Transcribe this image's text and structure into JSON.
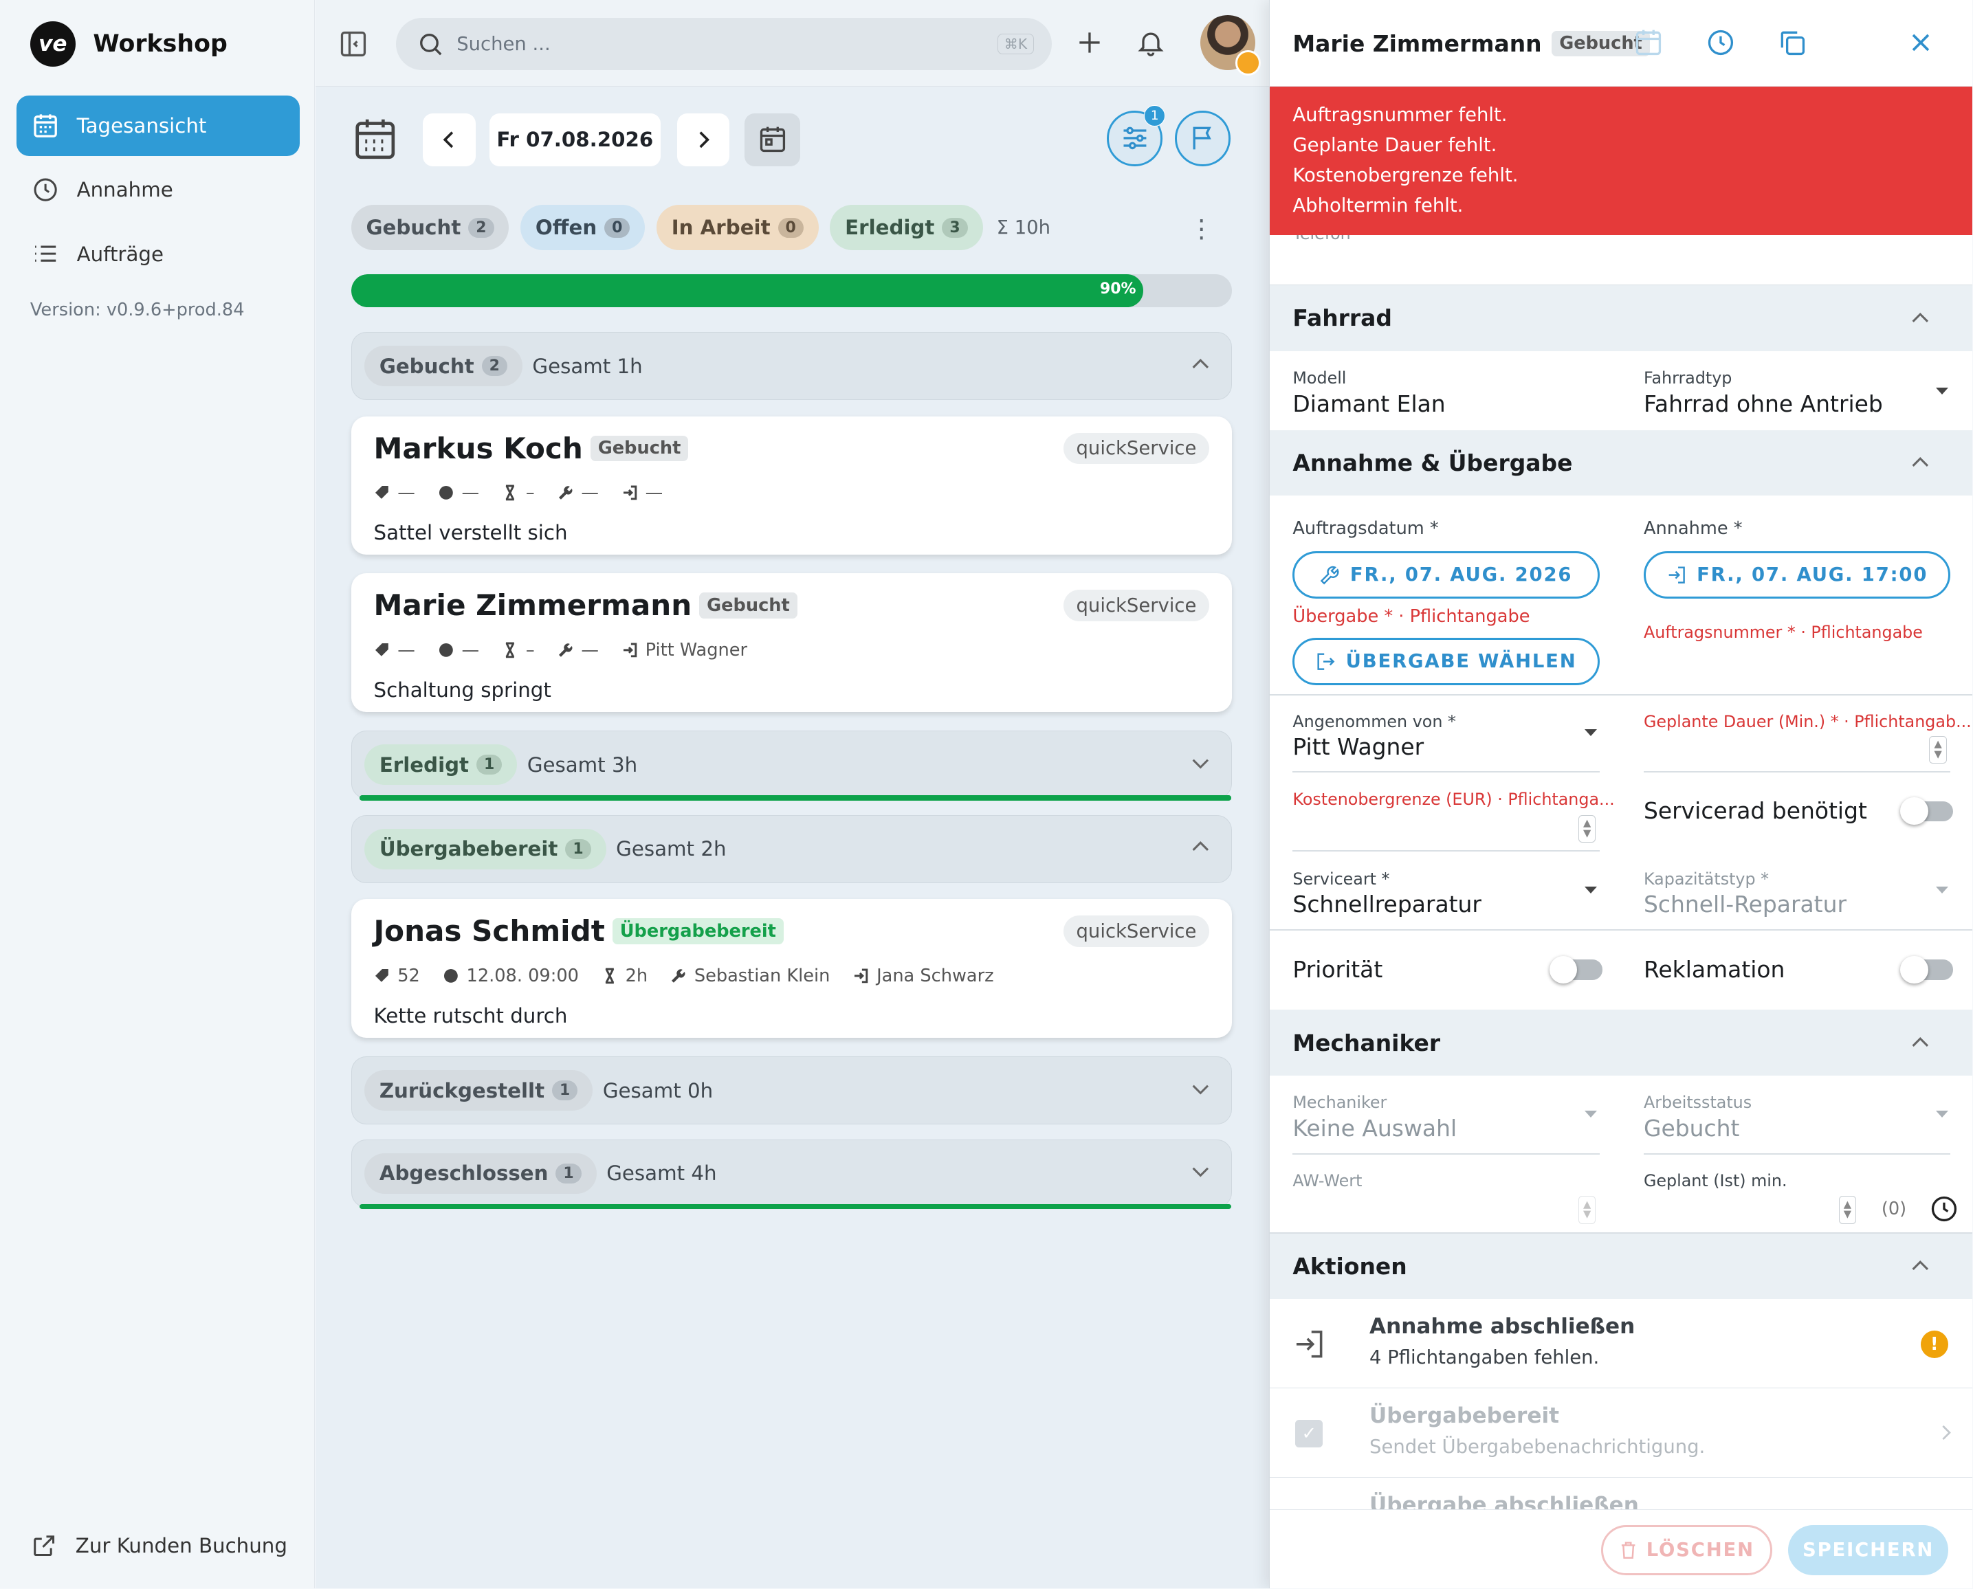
{
  "app": {
    "name": "Workshop",
    "version": "Version: v0.9.6+prod.84"
  },
  "sidebar": {
    "items": [
      {
        "label": "Tagesansicht",
        "icon": "calendar-icon",
        "active": true
      },
      {
        "label": "Annahme",
        "icon": "clock-icon"
      },
      {
        "label": "Aufträge",
        "icon": "list-icon"
      }
    ],
    "customer_link": "Zur Kunden Buchung"
  },
  "topbar": {
    "search_placeholder": "Suchen ...",
    "shortcut": "⌘K"
  },
  "datebar": {
    "date": "Fr 07.08.2026",
    "filter_badge": "1"
  },
  "status_chips": [
    {
      "label": "Gebucht",
      "count": "2"
    },
    {
      "label": "Offen",
      "count": "0"
    },
    {
      "label": "In Arbeit",
      "count": "0"
    },
    {
      "label": "Erledigt",
      "count": "3"
    }
  ],
  "sum_hours": "Σ 10h",
  "progress": {
    "value": 0.9,
    "label": "90%"
  },
  "groups": {
    "gebucht": {
      "label": "Gebucht",
      "count": "2",
      "total": "Gesamt 1h"
    },
    "erledigt": {
      "label": "Erledigt",
      "count": "1",
      "total": "Gesamt 3h"
    },
    "uebergabebereit": {
      "label": "Übergabebereit",
      "count": "1",
      "total": "Gesamt 2h"
    },
    "zurueckgestellt": {
      "label": "Zurückgestellt",
      "count": "1",
      "total": "Gesamt 0h"
    },
    "abgeschlossen": {
      "label": "Abgeschlossen",
      "count": "1",
      "total": "Gesamt 4h"
    }
  },
  "cards": [
    {
      "name": "Markus Koch",
      "status": "Gebucht",
      "service": "quickService",
      "tag": "—",
      "time": "—",
      "duration": "–",
      "mechanic": "—",
      "receiver": "—",
      "description": "Sattel verstellt sich"
    },
    {
      "name": "Marie Zimmermann",
      "status": "Gebucht",
      "service": "quickService",
      "tag": "—",
      "time": "—",
      "duration": "–",
      "mechanic": "—",
      "receiver": "Pitt Wagner",
      "description": "Schaltung springt"
    },
    {
      "name": "Jonas Schmidt",
      "status": "Übergabebereit",
      "service": "quickService",
      "tag": "52",
      "time": "12.08. 09:00",
      "duration": "2h",
      "mechanic": "Sebastian Klein",
      "receiver": "Jana Schwarz",
      "description": "Kette rutscht durch"
    }
  ],
  "panel": {
    "title": "Marie Zimmermann",
    "status": "Gebucht",
    "errors": [
      "Auftragsnummer fehlt.",
      "Geplante Dauer fehlt.",
      "Kostenobergrenze fehlt.",
      "Abholtermin fehlt."
    ],
    "partial_label": "Telefon",
    "fahrrad": {
      "title": "Fahrrad",
      "modell_label": "Modell",
      "modell": "Diamant Elan",
      "typ_label": "Fahrradtyp",
      "typ": "Fahrrad ohne Antrieb"
    },
    "annahme": {
      "title": "Annahme & Übergabe",
      "auftragsdatum_label": "Auftragsdatum *",
      "auftragsdatum": "FR., 07. AUG. 2026",
      "annahme_label": "Annahme *",
      "annahme": "FR., 07. AUG. 17:00",
      "uebergabe_error": "Übergabe * · Pflichtangabe",
      "auftragsnummer_error": "Auftragsnummer * · Pflichtangabe",
      "uebergabe_button": "ÜBERGABE WÄHLEN",
      "angenommen_label": "Angenommen von *",
      "angenommen": "Pitt Wagner",
      "dauer_error": "Geplante Dauer (Min.) * · Pflichtangab...",
      "kosten_error": "Kostenobergrenze (EUR) · Pflichtanga...",
      "servicerad": "Servicerad benötigt",
      "serviceart_label": "Serviceart *",
      "serviceart": "Schnellreparatur",
      "kapazitaet_label": "Kapazitätstyp *",
      "kapazitaet": "Schnell-Reparatur",
      "prioritaet": "Priorität",
      "reklamation": "Reklamation"
    },
    "mechaniker": {
      "title": "Mechaniker",
      "mechaniker_label": "Mechaniker",
      "mechaniker": "Keine Auswahl",
      "status_label": "Arbeitsstatus",
      "status": "Gebucht",
      "aw_label": "AW-Wert",
      "geplant_label": "Geplant (Ist) min.",
      "geplant_ist": "(0)"
    },
    "aktionen": {
      "title": "Aktionen",
      "items": [
        {
          "title": "Annahme abschließen",
          "subtitle": "4 Pflichtangaben fehlen."
        },
        {
          "title": "Übergabebereit",
          "subtitle": "Sendet Übergabebenachrichtigung."
        },
        {
          "title": "Übergabe abschließen",
          "subtitle": ""
        }
      ]
    },
    "footer": {
      "delete": "LÖSCHEN",
      "save": "SPEICHERN"
    }
  },
  "colors": {
    "accent": "#2f9bd6",
    "error": "#e53a3a",
    "success": "#0ca24a",
    "warning": "#f0a30a"
  }
}
